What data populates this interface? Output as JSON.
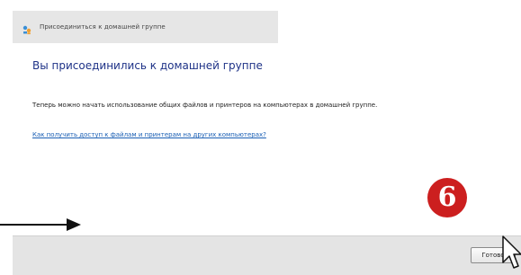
{
  "window": {
    "title": "Присоединиться к домашней группе",
    "heading": "Вы присоединились к домашней группе",
    "body": "Теперь можно начать использование общих файлов и принтеров на компьютерах в домашней группе.",
    "help_link": "Как получить доступ к файлам и принтерам на других компьютерах?"
  },
  "footer": {
    "done_label": "Готово"
  },
  "annotation": {
    "step_number": "6",
    "badge_color": "#cc1f1f",
    "arrow_color": "#111111"
  },
  "icons": {
    "title_icon": "homegroup-icon",
    "pointer": "mouse-cursor-icon",
    "arrow": "arrow-right-icon"
  }
}
